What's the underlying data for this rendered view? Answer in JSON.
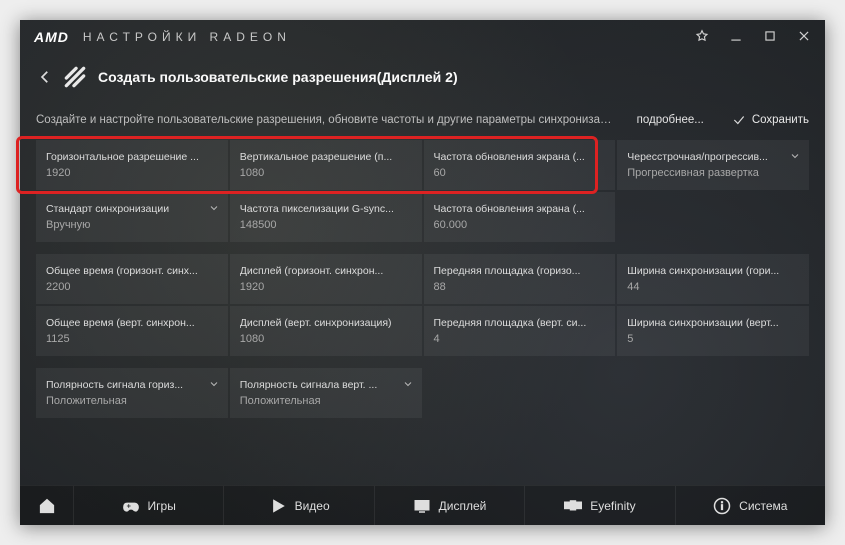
{
  "window": {
    "brand": "AMD",
    "title": "НАСТРОЙКИ RADEON"
  },
  "header": {
    "page_title": "Создать пользовательские разрешения(Дисплей 2)"
  },
  "desc": {
    "text": "Создайте и настройте пользовательские разрешения, обновите частоты и другие параметры синхронизации...",
    "more": "подробнее...",
    "save": "Сохранить"
  },
  "cells": {
    "r1c1": {
      "label": "Горизонтальное разрешение ...",
      "value": "1920",
      "dropdown": false
    },
    "r1c2": {
      "label": "Вертикальное разрешение (п...",
      "value": "1080",
      "dropdown": false
    },
    "r1c3": {
      "label": "Частота обновления экрана (...",
      "value": "60",
      "dropdown": false
    },
    "r1c4": {
      "label": "Чересстрочная/прогрессив...",
      "value": "Прогрессивная развертка",
      "dropdown": true
    },
    "r2c1": {
      "label": "Стандарт синхронизации",
      "value": "Вручную",
      "dropdown": true
    },
    "r2c2": {
      "label": "Частота пикселизации G-sync...",
      "value": "148500",
      "dropdown": false
    },
    "r2c3": {
      "label": "Частота обновления экрана (...",
      "value": "60.000",
      "dropdown": false
    },
    "r3c1": {
      "label": "Общее время (горизонт. синх...",
      "value": "2200",
      "dropdown": false
    },
    "r3c2": {
      "label": "Дисплей (горизонт. синхрон...",
      "value": "1920",
      "dropdown": false
    },
    "r3c3": {
      "label": "Передняя площадка (горизо...",
      "value": "88",
      "dropdown": false
    },
    "r3c4": {
      "label": "Ширина синхронизации (гори...",
      "value": "44",
      "dropdown": false
    },
    "r4c1": {
      "label": "Общее время (верт. синхрон...",
      "value": "1125",
      "dropdown": false
    },
    "r4c2": {
      "label": "Дисплей (верт. синхронизация)",
      "value": "1080",
      "dropdown": false
    },
    "r4c3": {
      "label": "Передняя площадка (верт. си...",
      "value": "4",
      "dropdown": false
    },
    "r4c4": {
      "label": "Ширина синхронизации (верт...",
      "value": "5",
      "dropdown": false
    },
    "r5c1": {
      "label": "Полярность сигнала гориз...",
      "value": "Положительная",
      "dropdown": true
    },
    "r5c2": {
      "label": "Полярность сигнала верт. ...",
      "value": "Положительная",
      "dropdown": true
    }
  },
  "nav": {
    "games": "Игры",
    "video": "Видео",
    "display": "Дисплей",
    "eyefinity": "Eyefinity",
    "system": "Система"
  }
}
